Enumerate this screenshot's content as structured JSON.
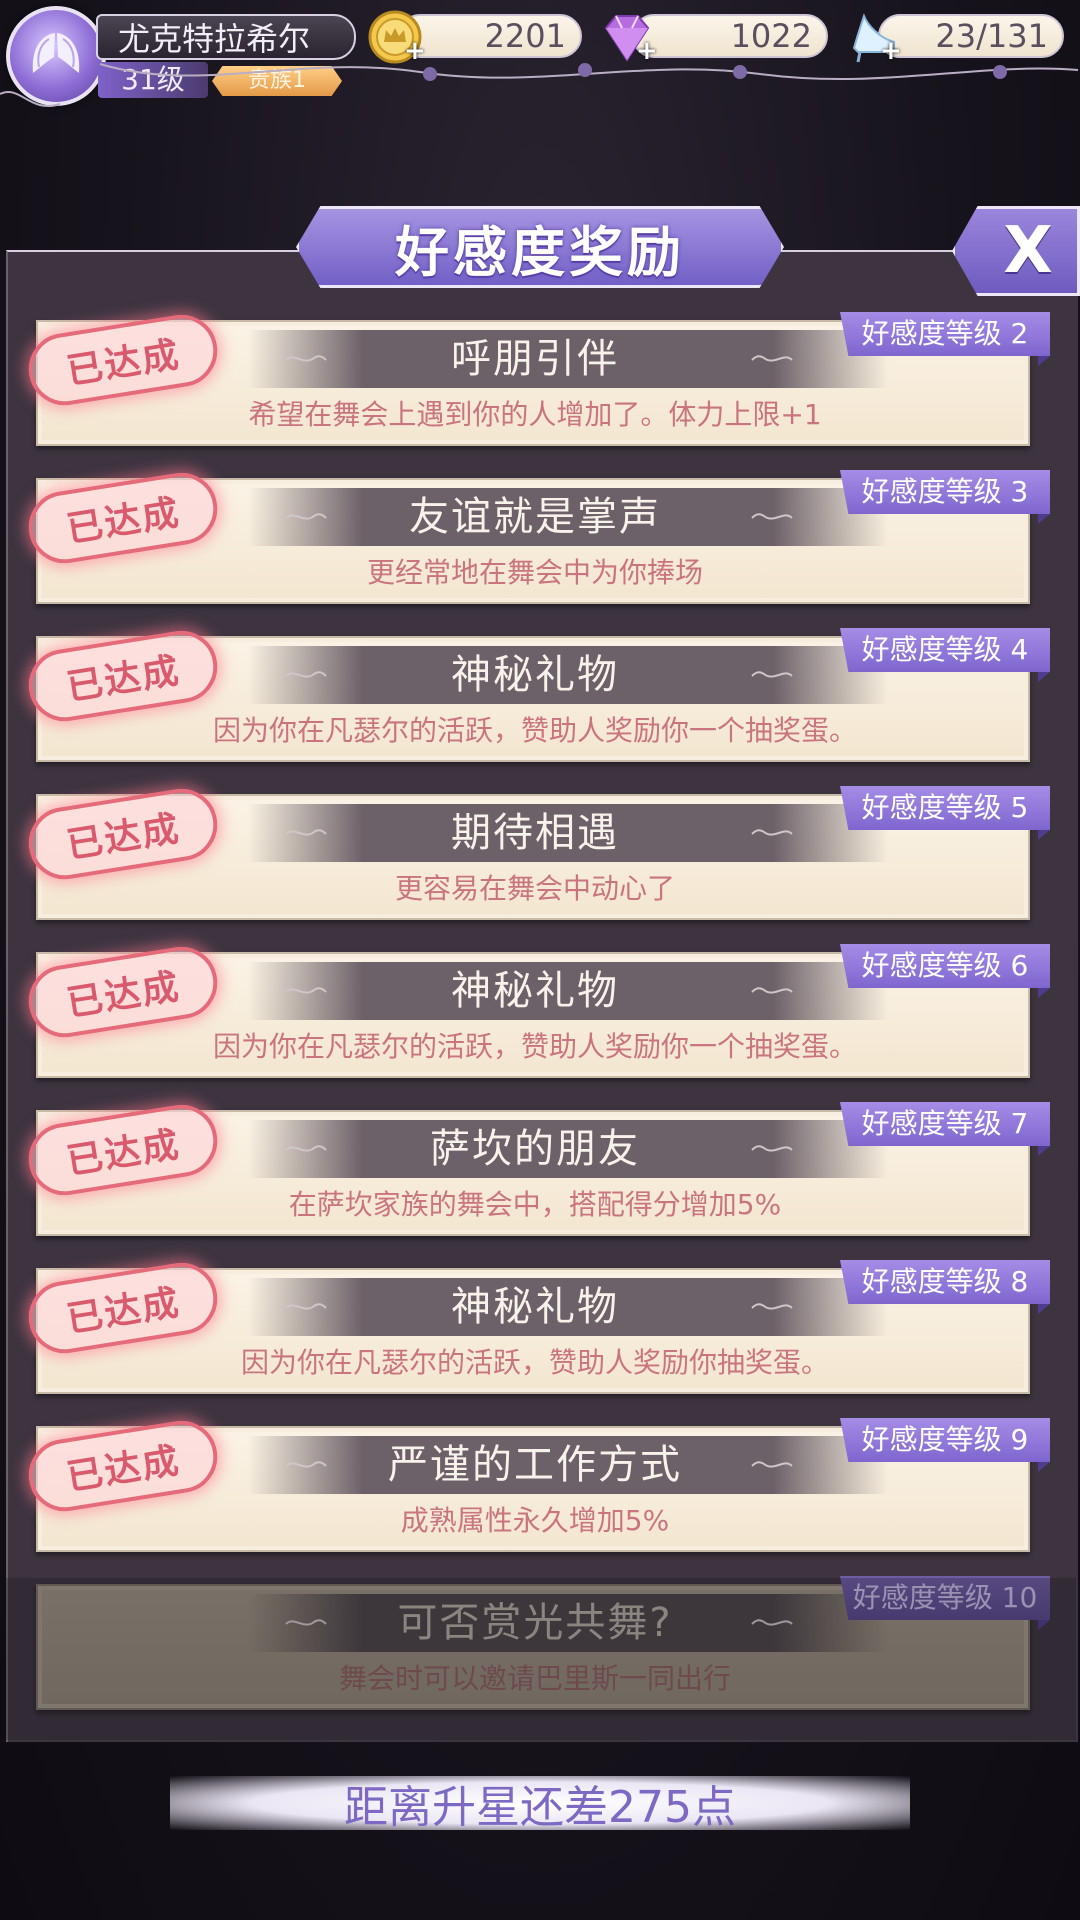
{
  "player": {
    "name": "尤克特拉希尔",
    "level": "31级",
    "rank": "贵族1"
  },
  "resources": {
    "gold": "2201",
    "diamonds": "1022",
    "stamina": "23/131"
  },
  "panel": {
    "title": "好感度奖励",
    "close_label": "X"
  },
  "achieved_stamp": "已达成",
  "rewards": [
    {
      "level_tag": "好感度等级 2",
      "title": "呼朋引伴",
      "desc": "希望在舞会上遇到你的人增加了。体力上限+1",
      "achieved": true
    },
    {
      "level_tag": "好感度等级 3",
      "title": "友谊就是掌声",
      "desc": "更经常地在舞会中为你捧场",
      "achieved": true
    },
    {
      "level_tag": "好感度等级 4",
      "title": "神秘礼物",
      "desc": "因为你在凡瑟尔的活跃，赞助人奖励你一个抽奖蛋。",
      "achieved": true
    },
    {
      "level_tag": "好感度等级 5",
      "title": "期待相遇",
      "desc": "更容易在舞会中动心了",
      "achieved": true
    },
    {
      "level_tag": "好感度等级 6",
      "title": "神秘礼物",
      "desc": "因为你在凡瑟尔的活跃，赞助人奖励你一个抽奖蛋。",
      "achieved": true
    },
    {
      "level_tag": "好感度等级 7",
      "title": "萨坎的朋友",
      "desc": "在萨坎家族的舞会中，搭配得分增加5%",
      "achieved": true
    },
    {
      "level_tag": "好感度等级 8",
      "title": "神秘礼物",
      "desc": "因为你在凡瑟尔的活跃，赞助人奖励你抽奖蛋。",
      "achieved": true
    },
    {
      "level_tag": "好感度等级 9",
      "title": "严谨的工作方式",
      "desc": "成熟属性永久增加5%",
      "achieved": true
    },
    {
      "level_tag": "好感度等级 10",
      "title": "可否赏光共舞?",
      "desc": "舞会时可以邀请巴里斯一同出行",
      "achieved": false
    }
  ],
  "footer": {
    "progress_text": "距离升星还差275点"
  },
  "colors": {
    "accent_purple": "#8a72d6",
    "stamp_pink": "#e56a7a",
    "desc_pink": "#c9747e"
  }
}
